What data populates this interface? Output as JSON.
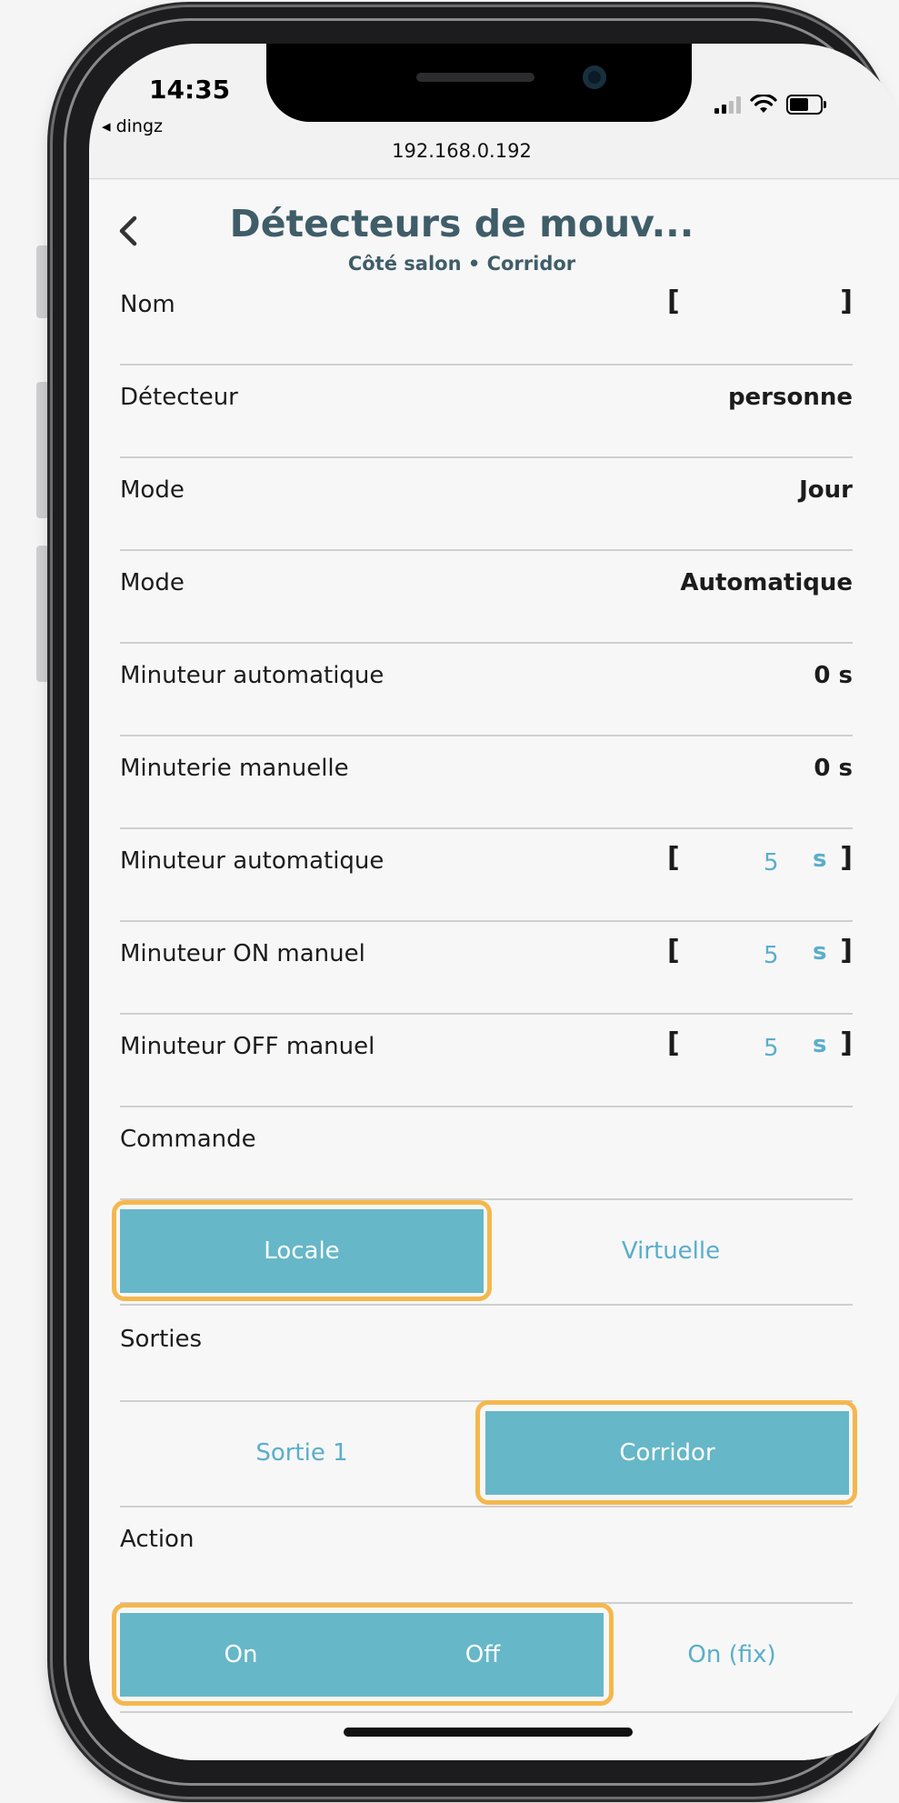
{
  "status_bar": {
    "time": "14:35",
    "back_app": "◂ dingz",
    "url": "192.168.0.192"
  },
  "header": {
    "title": "Détecteurs de mouv...",
    "subtitle": "Côté salon • Corridor"
  },
  "rows": [
    {
      "label": "Nom",
      "value": ""
    },
    {
      "label": "Détecteur",
      "value": "personne"
    },
    {
      "label": "Mode",
      "value": "Jour"
    },
    {
      "label": "Mode",
      "value": "Automatique"
    },
    {
      "label": "Minuteur automatique",
      "value": "0 s"
    },
    {
      "label": "Minuterie manuelle",
      "value": "0 s"
    },
    {
      "label": "Minuteur automatique",
      "value": "5",
      "unit": "s"
    },
    {
      "label": "Minuteur ON manuel",
      "value": "5",
      "unit": "s"
    },
    {
      "label": "Minuteur OFF manuel",
      "value": "5",
      "unit": "s"
    }
  ],
  "brackets": {
    "open": "[",
    "close": "]"
  },
  "commande": {
    "label": "Commande",
    "options": [
      "Locale",
      "Virtuelle"
    ],
    "selected": "Locale"
  },
  "sorties": {
    "label": "Sorties",
    "options": [
      "Sortie 1",
      "Corridor"
    ],
    "selected": "Corridor"
  },
  "action": {
    "label": "Action",
    "options": [
      "On",
      "Off",
      "On (fix)"
    ],
    "selected": [
      "On",
      "Off"
    ]
  },
  "colors": {
    "accent": "#66b7c8",
    "accent_text": "#5aaeca",
    "title": "#3f5d68",
    "highlight": "#f5b74d"
  }
}
